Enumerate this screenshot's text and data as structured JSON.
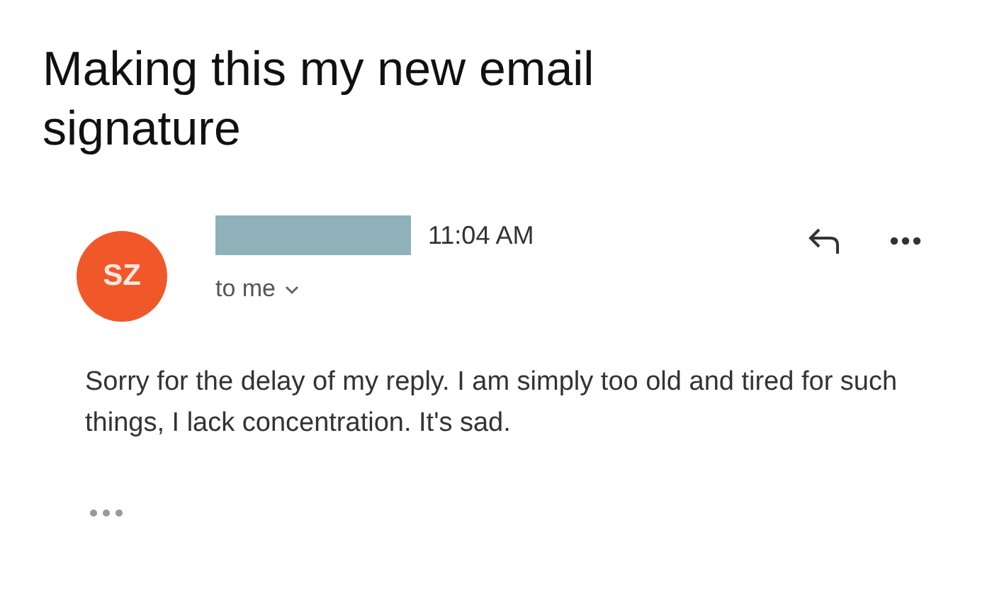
{
  "caption": "Making this my new email signature",
  "email": {
    "avatar_initials": "SZ",
    "time": "11:04 AM",
    "recipient": "to me",
    "body": "Sorry for the delay of my reply. I am simply too old and tired for such things, I lack concentration. It's sad."
  }
}
